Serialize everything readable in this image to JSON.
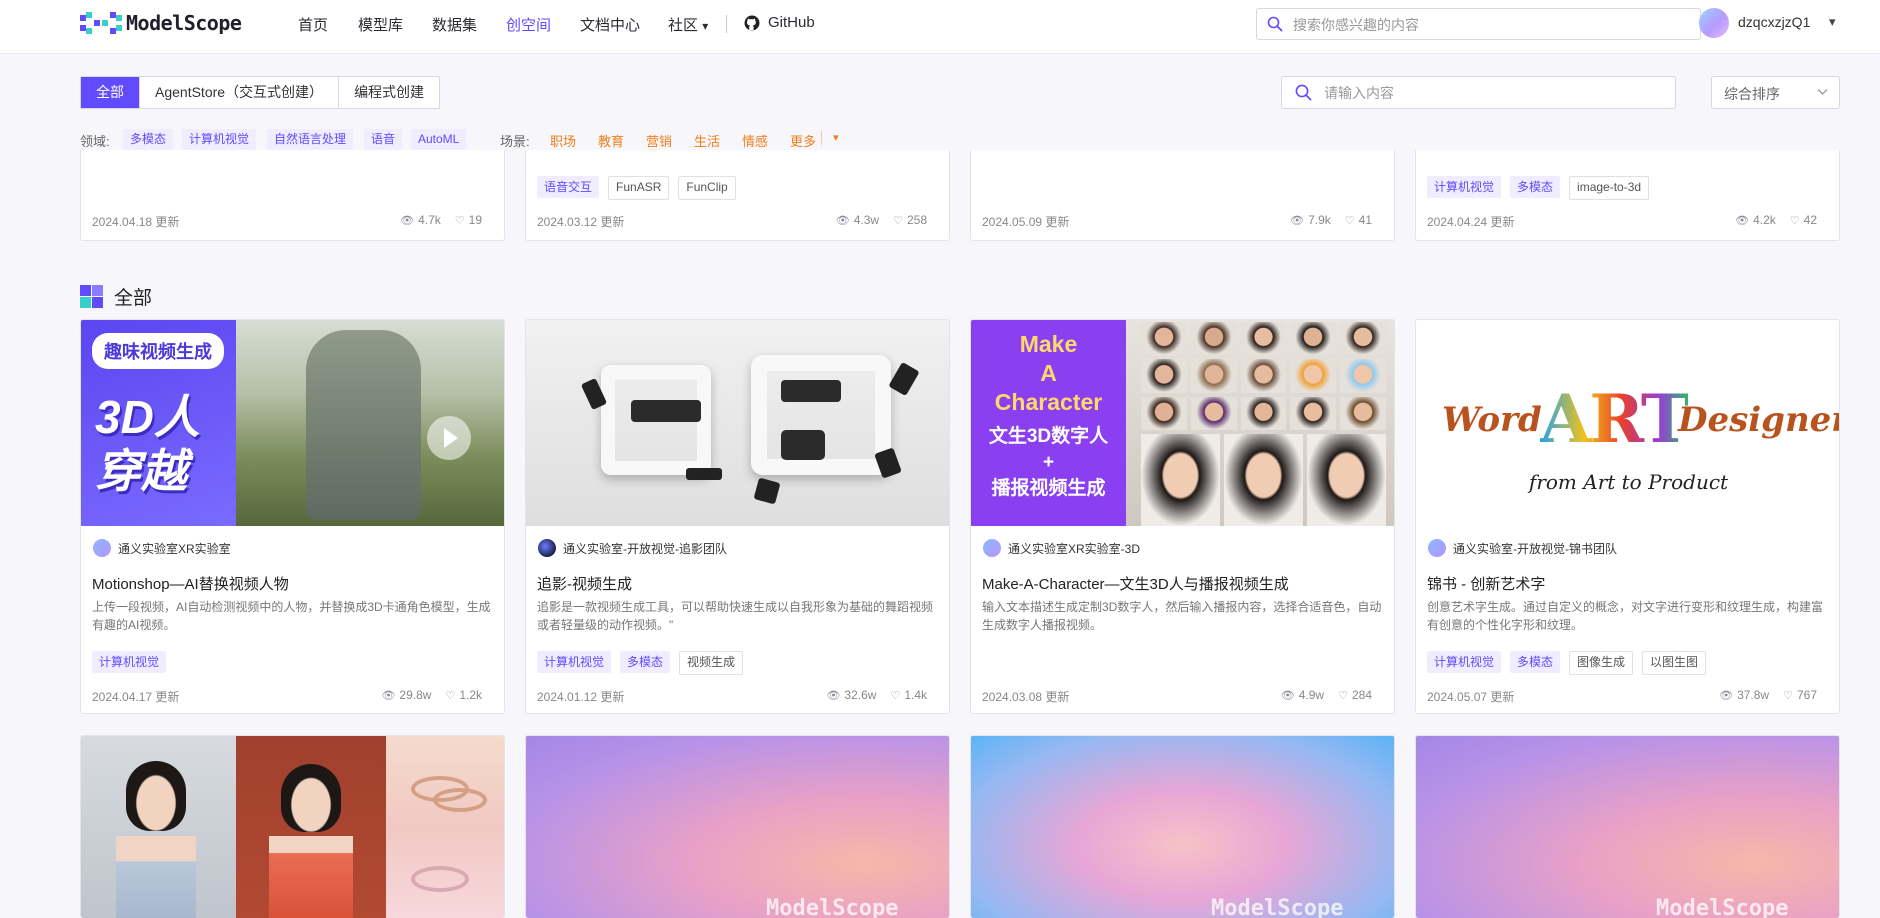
{
  "header": {
    "logo_text": "ModelScope",
    "nav": [
      "首页",
      "模型库",
      "数据集",
      "创空间",
      "文档中心",
      "社区",
      "GitHub"
    ],
    "active_nav": "创空间",
    "community_caret": "▾",
    "search_placeholder": "搜索你感兴趣的内容",
    "username": "dzqcxzjzQ1",
    "user_caret": "▾"
  },
  "filters": {
    "tabs": [
      "全部",
      "AgentStore（交互式创建）",
      "编程式创建"
    ],
    "active_tab": "全部",
    "search_placeholder": "请输入内容",
    "sort": "综合排序",
    "domain_label": "领域:",
    "domains": [
      "多模态",
      "计算机视觉",
      "自然语言处理",
      "语音",
      "AutoML"
    ],
    "scene_label": "场景:",
    "scenes": [
      "职场",
      "教育",
      "营销",
      "生活",
      "情感",
      "更多"
    ],
    "scene_more_caret": "▾"
  },
  "top_row": [
    {
      "tags": [],
      "date": "2024.04.18 更新",
      "views": "4.7k",
      "likes": "19"
    },
    {
      "tags": [
        "语音交互",
        "FunASR",
        "FunClip"
      ],
      "date": "2024.03.12 更新",
      "views": "4.3w",
      "likes": "258"
    },
    {
      "tags": [],
      "date": "2024.05.09 更新",
      "views": "7.9k",
      "likes": "41"
    },
    {
      "tags": [
        "计算机视觉",
        "多模态",
        "image-to-3d"
      ],
      "date": "2024.04.24 更新",
      "views": "4.2k",
      "likes": "42"
    }
  ],
  "section": {
    "title": "全部"
  },
  "cards": [
    {
      "org": "通义实验室XR实验室",
      "title": "Motionshop—AI替换视频人物",
      "desc": "上传一段视频，AI自动检测视频中的人物，并替换成3D卡通角色模型，生成有趣的AI视频。",
      "tags": [
        "计算机视觉"
      ],
      "date": "2024.04.17 更新",
      "views": "29.8w",
      "likes": "1.2k",
      "thumb": {
        "badge": "趣味视频生成",
        "big_text": "3D人\n穿越"
      }
    },
    {
      "org": "通义实验室-开放视觉-追影团队",
      "title": "追影-视频生成",
      "desc": "追影是一款视频生成工具，可以帮助快速生成以自我形象为基础的舞蹈视频或者轻量级的动作视频。\"",
      "tags": [
        "计算机视觉",
        "多模态",
        "视频生成"
      ],
      "date": "2024.01.12 更新",
      "views": "32.6w",
      "likes": "1.4k",
      "thumb": {}
    },
    {
      "org": "通义实验室XR实验室-3D",
      "title": "Make-A-Character—文生3D人与播报视频生成",
      "desc": "输入文本描述生成定制3D数字人，然后输入播报内容，选择合适音色，自动生成数字人播报视频。",
      "tags": [],
      "date": "2024.03.08 更新",
      "views": "4.9w",
      "likes": "284",
      "thumb": {
        "line1": "Make",
        "line2": "A",
        "line3": "Character",
        "cn1": "文生3D数字人",
        "plus": "+",
        "cn2": "播报视频生成"
      }
    },
    {
      "org": "通义实验室-开放视觉-锦书团队",
      "title": "锦书 - 创新艺术字",
      "desc": "创意艺术字生成。通过自定义的概念，对文字进行变形和纹理生成，构建富有创意的个性化字形和纹理。",
      "tags": [
        "计算机视觉",
        "多模态",
        "图像生成",
        "以图生图"
      ],
      "date": "2024.05.07 更新",
      "views": "37.8w",
      "likes": "767",
      "thumb": {
        "word": "Word",
        "art": "ART",
        "designer": "Designer",
        "sub": "from Art to Product"
      }
    }
  ],
  "bottom_row": [
    {
      "type": "photo"
    },
    {
      "type": "gradient",
      "watermark": "ModelScope"
    },
    {
      "type": "gradient",
      "watermark": "ModelScope"
    },
    {
      "type": "gradient",
      "watermark": "ModelScope"
    }
  ],
  "colors": {
    "accent": "#624aff",
    "scene": "#f07f1a",
    "tag_bg": "#efedff"
  }
}
